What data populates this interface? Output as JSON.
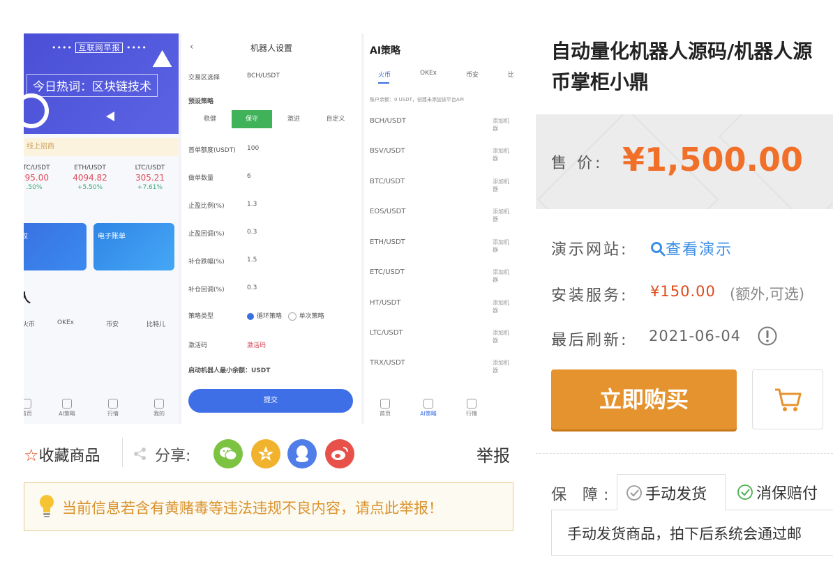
{
  "product_image": {
    "panel1": {
      "banner_top": "互联网早报",
      "banner_title": "今日热词：区块链技术",
      "notice": "线上招商",
      "tickers": [
        {
          "pair": "BTC/USDT",
          "price": "",
          "change": ""
        },
        {
          "pair": "ETH/USDT",
          "price": "4094.82",
          "change": "+5.50%"
        },
        {
          "pair": "LTC/USDT",
          "price": "305.21",
          "change": "+7.61%"
        }
      ],
      "card1_label": "授权",
      "card2_label": "电子账单",
      "robot_title": "人",
      "exchange_tabs": [
        "火币",
        "OKEx",
        "币安",
        "比特儿"
      ],
      "nav": [
        "首页",
        "AI策略",
        "行情",
        "我的"
      ]
    },
    "panel2": {
      "header": "机器人设置",
      "rows": [
        {
          "label": "交易区选择",
          "value": "BCH/USDT"
        },
        {
          "label": "预设策略",
          "value": ""
        },
        {
          "label": "首单额度(USDT)",
          "value": "100"
        },
        {
          "label": "做单数量",
          "value": "6"
        },
        {
          "label": "止盈比例(%)",
          "value": "1.3"
        },
        {
          "label": "止盈回调(%)",
          "value": "0.3"
        },
        {
          "label": "补仓跌幅(%)",
          "value": "1.5"
        },
        {
          "label": "补仓回调(%)",
          "value": "0.3"
        },
        {
          "label": "策略类型",
          "value": ""
        },
        {
          "label": "激活码",
          "value": "激活码"
        }
      ],
      "strategy_buttons": [
        "稳健",
        "保守",
        "激进",
        "自定义"
      ],
      "active_strategy": "保守",
      "loop_strategy": "循环策略",
      "single_strategy": "单次策略",
      "min_note": "启动机器人最小余额：USDT",
      "submit": "提交"
    },
    "panel3": {
      "title": "AI策略",
      "tabs": [
        "火币",
        "OKEx",
        "币安",
        "比"
      ],
      "hint": "账户余额：0 USDT，创建未添加该平台API",
      "pairs": [
        "BCH/USDT",
        "BSV/USDT",
        "BTC/USDT",
        "EOS/USDT",
        "ETH/USDT",
        "ETC/USDT",
        "HT/USDT",
        "LTC/USDT",
        "TRX/USDT"
      ],
      "pair_action": "添加机器",
      "nav": [
        "首页",
        "AI策略",
        "行情"
      ]
    }
  },
  "actions": {
    "collect": "收藏商品",
    "share": "分享:",
    "report": "举报",
    "share_colors": [
      "#7cc341",
      "#f1b32e",
      "#4f7ee8",
      "#e8514a"
    ]
  },
  "warning": "当前信息若含有黄赌毒等违法违规不良内容，请点此举报！",
  "product": {
    "title_line1": "自动量化机器人源码/机器人源",
    "title_line2": "币掌柜小鼎",
    "price_label": "售 价:",
    "price": "¥1,500.00",
    "demo_label": "演示网站:",
    "demo_link": "查看演示",
    "install_label": "安装服务:",
    "install_price": "¥150.00",
    "install_note": "(额外,可选)",
    "refresh_label": "最后刷新:",
    "refresh_date": "2021-06-04",
    "buy_button": "立即购买",
    "guarantee_label": "保 障:",
    "guarantee_tabs": [
      "手动发货",
      "消保赔付"
    ],
    "guarantee_text": "手动发货商品，拍下后系统会通过邮",
    "accent_color": "#e5932e",
    "price_color": "#f0702a"
  }
}
